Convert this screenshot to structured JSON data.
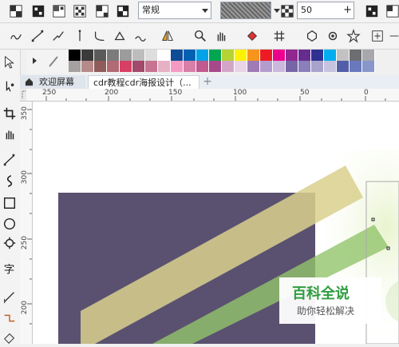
{
  "toolbar1": {
    "style_select": "常规",
    "number_value": "50"
  },
  "icons": {
    "row1": [
      "checker-icon",
      "checker-fill-icon",
      "checker-dots-icon",
      "checker-gradient-icon",
      "checker-pattern-icon"
    ],
    "row2": [
      "freehand-icon",
      "line-icon",
      "polyline-icon",
      "bezier-icon",
      "pen-icon",
      "shape-icon",
      "artistic-media-icon",
      "mirror-icon",
      "zoom-icon",
      "pan-icon",
      "fill-icon",
      "grid-icon",
      "hexagon-icon",
      "cog-icon",
      "star-icon"
    ]
  },
  "palette": {
    "row1": [
      "#000000",
      "#3a3a3a",
      "#5a5a5a",
      "#7b7b7b",
      "#9c9c9c",
      "#bdbdbd",
      "#dedede",
      "#ffffff",
      "#0e4c97",
      "#0061b3",
      "#00a2e8",
      "#00a650",
      "#b5d334",
      "#fff200",
      "#f7941d",
      "#ed1c24",
      "#ec008c",
      "#92278f",
      "#662d91",
      "#2e3192",
      "#00aeef",
      "#c2c2c2",
      "#6d6e71",
      "#a6a8ab"
    ],
    "row2": [
      "#a7a0a0",
      "#b78a8a",
      "#8f5b5b",
      "#b06a74",
      "#d83f64",
      "#a14a6b",
      "#c77391",
      "#e6b1c3",
      "#f49ac2",
      "#d77fa7",
      "#c05a8f",
      "#a6498b",
      "#d3a5c8",
      "#e8d4e6",
      "#9e7bb5",
      "#b49ccf",
      "#cab8dd",
      "#7766a6",
      "#8a7fba",
      "#a7a3cc",
      "#c6c2e0",
      "#525fa8",
      "#6a79bd",
      "#8896cb"
    ]
  },
  "tabs": [
    {
      "label": "欢迎屏幕"
    },
    {
      "label": "cdr教程cdr海报设计（..."
    }
  ],
  "ruler_h": [
    "250",
    "200",
    "150",
    "100",
    "50",
    "0"
  ],
  "ruler_v": [
    "350",
    "300",
    "250",
    "200"
  ],
  "watermark": {
    "title": "百科全说",
    "subtitle": "助你轻松解决"
  },
  "colors": {
    "rect": "#5a5170",
    "yellow_band": "#d9d08d",
    "green_band": "#92c46c",
    "accent": "#2f9d3f"
  }
}
